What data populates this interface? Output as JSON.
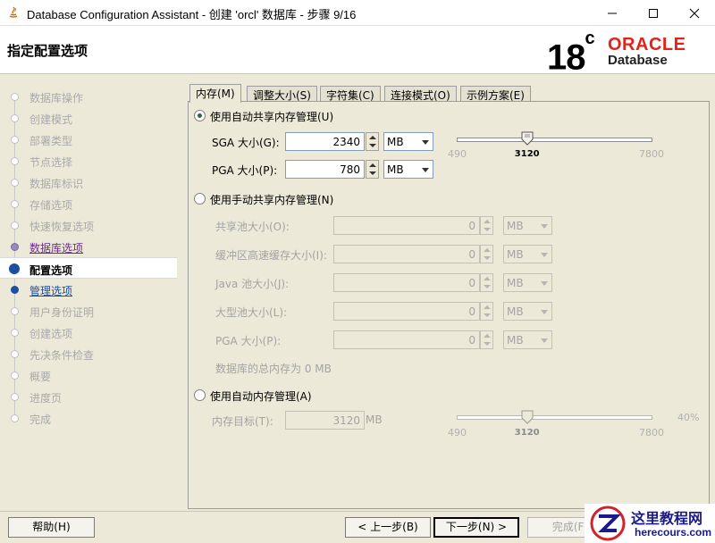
{
  "window": {
    "title": "Database Configuration Assistant - 创建 'orcl' 数据库 - 步骤 9/16"
  },
  "header": {
    "step_title": "指定配置选项",
    "logo_version": "18",
    "logo_version_sup": "c",
    "logo_brand": "ORACLE",
    "logo_sub": "Database"
  },
  "nav": {
    "items": [
      {
        "label": "数据库操作",
        "state": "done"
      },
      {
        "label": "创建模式",
        "state": "done"
      },
      {
        "label": "部署类型",
        "state": "done"
      },
      {
        "label": "节点选择",
        "state": "done"
      },
      {
        "label": "数据库标识",
        "state": "done"
      },
      {
        "label": "存储选项",
        "state": "done"
      },
      {
        "label": "快速恢复选项",
        "state": "done"
      },
      {
        "label": "数据库选项",
        "state": "visited"
      },
      {
        "label": "配置选项",
        "state": "current"
      },
      {
        "label": "管理选项",
        "state": "next"
      },
      {
        "label": "用户身份证明",
        "state": "pending"
      },
      {
        "label": "创建选项",
        "state": "pending"
      },
      {
        "label": "先决条件检查",
        "state": "pending"
      },
      {
        "label": "概要",
        "state": "pending"
      },
      {
        "label": "进度页",
        "state": "pending"
      },
      {
        "label": "完成",
        "state": "pending"
      }
    ]
  },
  "tabs": [
    {
      "label": "内存(M)",
      "active": true
    },
    {
      "label": "调整大小(S)",
      "active": false
    },
    {
      "label": "字符集(C)",
      "active": false
    },
    {
      "label": "连接模式(O)",
      "active": false
    },
    {
      "label": "示例方案(E)",
      "active": false
    }
  ],
  "memory": {
    "asmm": {
      "label": "使用自动共享内存管理(U)",
      "selected": true,
      "sga_label": "SGA 大小(G):",
      "sga_value": "2340",
      "sga_unit": "MB",
      "pga_label": "PGA 大小(P):",
      "pga_value": "780",
      "pga_unit": "MB",
      "slider_min": "490",
      "slider_max": "7800",
      "slider_current": "3120",
      "slider_value": 3120
    },
    "manual": {
      "label": "使用手动共享内存管理(N)",
      "selected": false,
      "fields": [
        {
          "label": "共享池大小(O):",
          "value": "0",
          "unit": "MB"
        },
        {
          "label": "缓冲区高速缓存大小(I):",
          "value": "0",
          "unit": "MB"
        },
        {
          "label": "Java 池大小(J):",
          "value": "0",
          "unit": "MB"
        },
        {
          "label": "大型池大小(L):",
          "value": "0",
          "unit": "MB"
        },
        {
          "label": "PGA 大小(P):",
          "value": "0",
          "unit": "MB"
        }
      ],
      "total_text": "数据库的总内存为 0 MB"
    },
    "amm": {
      "label": "使用自动内存管理(A)",
      "selected": false,
      "target_label": "内存目标(T):",
      "target_value": "3120",
      "target_unit": "MB",
      "slider_min": "490",
      "slider_max": "7800",
      "slider_current": "3120",
      "slider_value": 3120,
      "percent": "40%"
    }
  },
  "buttons": {
    "help": "帮助(H)",
    "back": "< 上一步(B)",
    "next": "下一步(N) >",
    "finish": "完成(F)"
  },
  "watermark": {
    "line1": "这里教程网",
    "line2": "herecours.com"
  }
}
